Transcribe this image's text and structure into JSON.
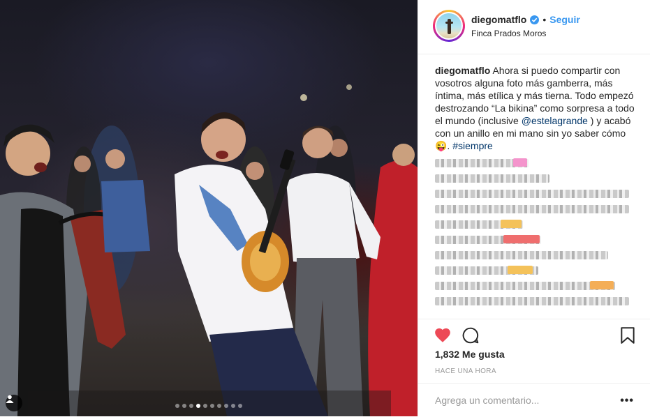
{
  "post": {
    "username": "diegomatflo",
    "follow_label": "Seguir",
    "separator": "•",
    "location": "Finca Prados Moros",
    "caption_user": "diegomatflo",
    "caption_part1": " Ahora si puedo compartir con vosotros alguna foto más gamberra, más íntima, más etílica y más tierna. Todo empezó destrozando “La bikina” como sorpresa a todo el mundo (inclusive ",
    "caption_mention": "@estelagrande",
    "caption_part2": " ) y acabó con un anillo en mi mano sin yo saber cómo 😜. ",
    "caption_hashtag": "#siempre",
    "likes": "1,832 Me gusta",
    "time_ago": "HACE UNA HORA",
    "comment_placeholder": "Agrega un comentario...",
    "more_label": "•••"
  },
  "carousel": {
    "count": 10,
    "active_index": 3
  },
  "icons": {
    "verified": "verified-badge-icon",
    "like": "heart-icon",
    "comment": "comment-icon",
    "save": "bookmark-icon",
    "tagged_users": "user-icon"
  },
  "colors": {
    "link": "#3897f0",
    "heart": "#ed4956",
    "mention": "#003569"
  }
}
